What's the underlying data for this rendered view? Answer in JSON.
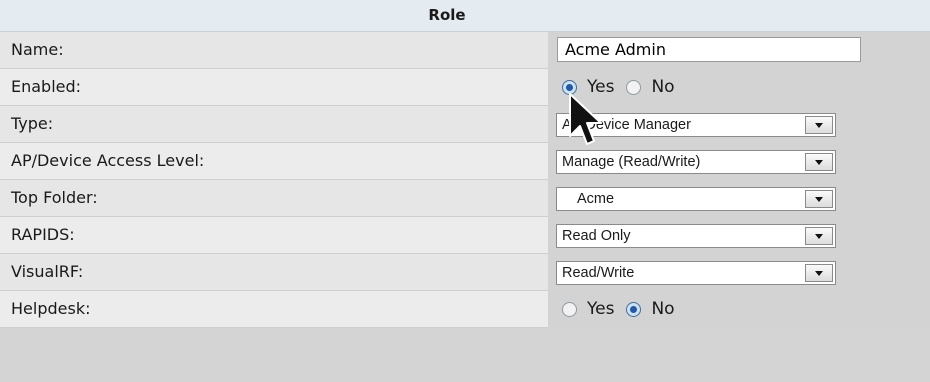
{
  "form": {
    "header": "Role",
    "name": {
      "label": "Name:",
      "value": "Acme Admin"
    },
    "enabled": {
      "label": "Enabled:",
      "options": [
        "Yes",
        "No"
      ],
      "selected": "Yes"
    },
    "type": {
      "label": "Type:",
      "value": "AP/Device Manager"
    },
    "access_level": {
      "label": "AP/Device Access Level:",
      "value": "Manage (Read/Write)"
    },
    "top_folder": {
      "label": "Top Folder:",
      "value": "Acme"
    },
    "rapids": {
      "label": "RAPIDS:",
      "value": "Read Only"
    },
    "visualrf": {
      "label": "VisualRF:",
      "value": "Read/Write"
    },
    "helpdesk": {
      "label": "Helpdesk:",
      "options": [
        "Yes",
        "No"
      ],
      "selected": "No"
    }
  },
  "icons": {
    "dropdown": "chevron-down-icon",
    "cursor": "mouse-pointer-icon"
  },
  "colors": {
    "header_bg": "#e4ebf1",
    "label_bg": "#e6e6e6",
    "value_bg": "#d3d3d3",
    "radio_checked": "#1f5aa8"
  }
}
